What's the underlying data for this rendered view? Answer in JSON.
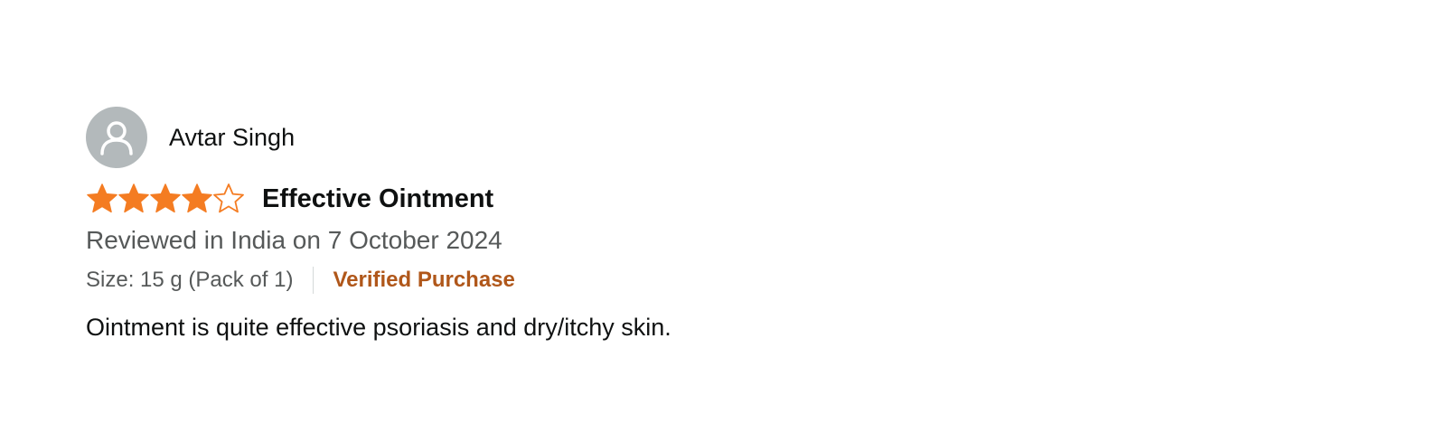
{
  "reviewer": {
    "name": "Avtar Singh",
    "avatar_icon": "user-silhouette-icon"
  },
  "review": {
    "rating": 4,
    "rating_max": 5,
    "star_color": "#f47c22",
    "title": "Effective Ointment",
    "date_line": "Reviewed in India on 7 October 2024",
    "variant": "Size: 15 g (Pack of 1)",
    "verified_label": "Verified Purchase",
    "verified_color": "#b0571a",
    "body": "Ointment is quite effective psoriasis and dry/itchy skin."
  }
}
